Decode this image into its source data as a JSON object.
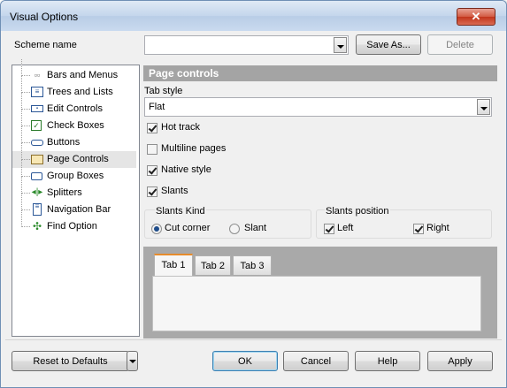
{
  "window": {
    "title": "Visual Options",
    "close_glyph": "✕"
  },
  "scheme": {
    "label": "Scheme name",
    "value": "",
    "save_as": "Save As...",
    "delete": "Delete"
  },
  "tree": {
    "items": [
      {
        "label": "Bars and Menus",
        "icon": "bars-menus-icon"
      },
      {
        "label": "Trees and Lists",
        "icon": "trees-lists-icon"
      },
      {
        "label": "Edit Controls",
        "icon": "edit-controls-icon"
      },
      {
        "label": "Check Boxes",
        "icon": "check-boxes-icon"
      },
      {
        "label": "Buttons",
        "icon": "buttons-icon"
      },
      {
        "label": "Page Controls",
        "icon": "page-controls-icon",
        "selected": true
      },
      {
        "label": "Group Boxes",
        "icon": "group-boxes-icon"
      },
      {
        "label": "Splitters",
        "icon": "splitters-icon"
      },
      {
        "label": "Navigation Bar",
        "icon": "navigation-bar-icon"
      },
      {
        "label": "Find Option",
        "icon": "find-option-icon"
      }
    ]
  },
  "page": {
    "header": "Page controls",
    "tab_style_label": "Tab style",
    "tab_style_value": "Flat",
    "hot_track": "Hot track",
    "multiline": "Multiline pages",
    "native_style": "Native style",
    "slants": "Slants",
    "slants_kind": {
      "label": "Slants Kind",
      "cut_corner": "Cut corner",
      "slant": "Slant"
    },
    "slants_position": {
      "label": "Slants position",
      "left": "Left",
      "right": "Right"
    },
    "preview_tabs": [
      "Tab 1",
      "Tab 2",
      "Tab 3"
    ]
  },
  "footer": {
    "reset": "Reset to Defaults",
    "ok": "OK",
    "cancel": "Cancel",
    "help": "Help",
    "apply": "Apply"
  },
  "colors": {
    "accent_tab": "#e68b2c",
    "header_bar": "#a4a4a4",
    "close": "#c2351c"
  }
}
